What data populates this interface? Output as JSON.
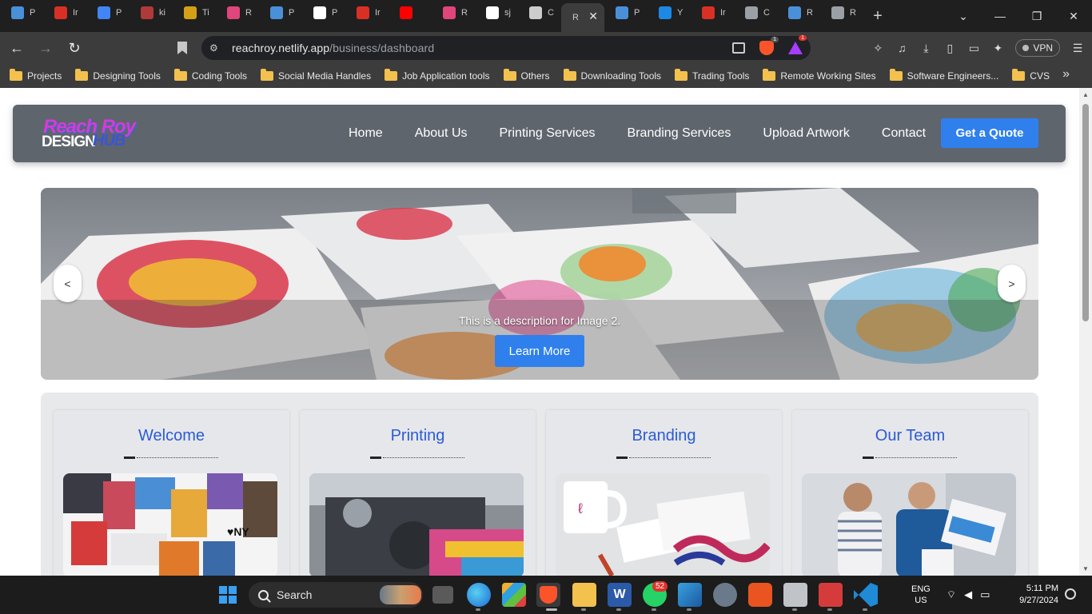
{
  "browser": {
    "tabs": [
      {
        "title": "P",
        "icon": "page-icon",
        "color": "#4a90d9"
      },
      {
        "title": "Ir",
        "icon": "gmail-icon",
        "color": "#d93025"
      },
      {
        "title": "P",
        "icon": "docs-icon",
        "color": "#4285f4"
      },
      {
        "title": "ki",
        "icon": "shield-icon",
        "color": "#b03a3a"
      },
      {
        "title": "Ti",
        "icon": "crown-icon",
        "color": "#d4a017"
      },
      {
        "title": "R",
        "icon": "eraser-icon",
        "color": "#e0457b"
      },
      {
        "title": "P",
        "icon": "page-icon",
        "color": "#4a90d9"
      },
      {
        "title": "P",
        "icon": "github-icon",
        "color": "#ffffff"
      },
      {
        "title": "Ir",
        "icon": "gauge-icon",
        "color": "#d93025"
      },
      {
        "title": "",
        "icon": "youtube-icon",
        "color": "#ff0000"
      },
      {
        "title": "R",
        "icon": "eraser-icon",
        "color": "#e0457b"
      },
      {
        "title": "sj",
        "icon": "github-icon",
        "color": "#ffffff"
      },
      {
        "title": "C",
        "icon": "openai-icon",
        "color": "#cccccc"
      },
      {
        "title": "R",
        "icon": "close-icon",
        "color": "#3c3c3c"
      },
      {
        "title": "P",
        "icon": "page-icon",
        "color": "#4a90d9"
      },
      {
        "title": "Y",
        "icon": "arrow-icon",
        "color": "#1e88e5"
      },
      {
        "title": "Ir",
        "icon": "gauge-icon",
        "color": "#d93025"
      },
      {
        "title": "C",
        "icon": "globe-icon",
        "color": "#9aa0a6"
      },
      {
        "title": "R",
        "icon": "page-icon",
        "color": "#4a90d9"
      },
      {
        "title": "R",
        "icon": "globe-icon",
        "color": "#9aa0a6"
      }
    ],
    "active_tab_title": "R",
    "url_host": "reachroy.netlify.app",
    "url_path": "/business/dashboard",
    "vpn_label": "VPN",
    "brave_badge": "1",
    "rewards_badge": "1",
    "bookmarks": [
      "Projects",
      "Designing Tools",
      "Coding Tools",
      "Social Media Handles",
      "Job Application tools",
      "Others",
      "Downloading Tools",
      "Trading Tools",
      "Remote Working Sites",
      "Software Engineers...",
      "CVS"
    ]
  },
  "site": {
    "logo": {
      "line1": "Reach Roy",
      "line2": "DESIGN",
      "line3": "HUB"
    },
    "nav": [
      "Home",
      "About Us",
      "Printing Services",
      "Branding Services",
      "Upload Artwork",
      "Contact"
    ],
    "cta": "Get a Quote",
    "hero": {
      "description": "This is a description for Image 2.",
      "button": "Learn More",
      "prev": "<",
      "next": ">"
    },
    "cards": [
      {
        "title": "Welcome"
      },
      {
        "title": "Printing"
      },
      {
        "title": "Branding"
      },
      {
        "title": "Our Team"
      }
    ],
    "colors": {
      "primary": "#2f80ed",
      "nav_bg": "#5f656d",
      "card_title": "#2a5bd7"
    }
  },
  "taskbar": {
    "search_label": "Search",
    "whatsapp_badge": "52",
    "lang_line1": "ENG",
    "lang_line2": "US",
    "time": "5:11 PM",
    "date": "9/27/2024"
  }
}
